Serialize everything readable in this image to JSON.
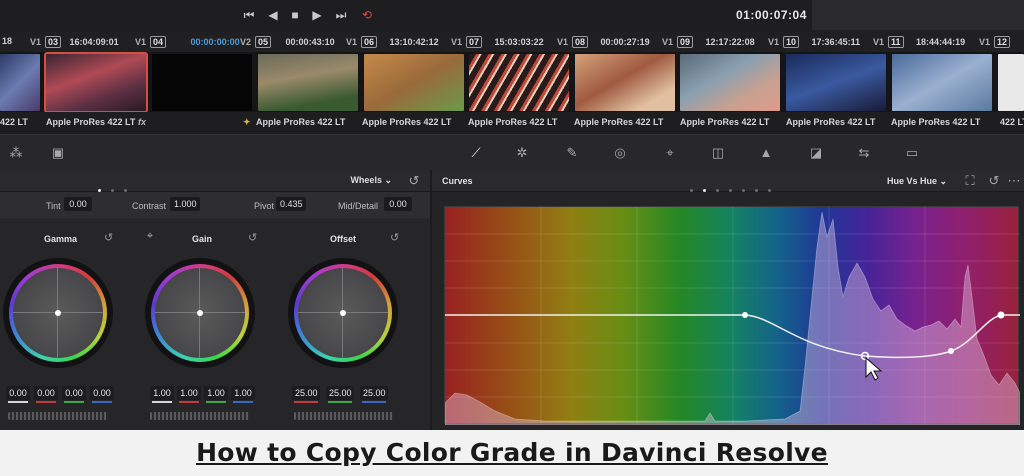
{
  "transport": {
    "timecode": "01:00:07:04",
    "buttons": [
      "skip-back-icon",
      "play-reverse-icon",
      "stop-icon",
      "play-icon",
      "skip-forward-icon",
      "loop-icon"
    ]
  },
  "timeline": {
    "clips": [
      {
        "num": "",
        "timecode": "",
        "track": "",
        "name": "422 LT"
      },
      {
        "num": "03",
        "timecode": "16:04:09:01",
        "track": "V1",
        "name": "Apple ProRes 422 LT",
        "fx": "fx"
      },
      {
        "num": "04",
        "timecode": "00:00:00:00",
        "track": "V1",
        "name": ""
      },
      {
        "num": "05",
        "timecode": "00:00:43:10",
        "track": "V2",
        "name": "Apple ProRes 422 LT"
      },
      {
        "num": "06",
        "timecode": "13:10:42:12",
        "track": "V1",
        "name": "Apple ProRes 422 LT"
      },
      {
        "num": "07",
        "timecode": "15:03:03:22",
        "track": "V1",
        "name": "Apple ProRes 422 LT"
      },
      {
        "num": "08",
        "timecode": "00:00:27:19",
        "track": "V1",
        "name": "Apple ProRes 422 LT"
      },
      {
        "num": "09",
        "timecode": "12:17:22:08",
        "track": "V1",
        "name": "Apple ProRes 422 LT"
      },
      {
        "num": "10",
        "timecode": "17:36:45:11",
        "track": "V1",
        "name": "Apple ProRes 422 LT"
      },
      {
        "num": "11",
        "timecode": "18:44:44:19",
        "track": "V1",
        "name": "Apple ProRes 422 LT"
      },
      {
        "num": "12",
        "timecode": "",
        "track": "V1",
        "name": "422 LT"
      }
    ],
    "first_tc": "18"
  },
  "wheels_panel": {
    "mode": "Wheels",
    "params": {
      "tint_label": "Tint",
      "tint": "0.00",
      "contrast_label": "Contrast",
      "contrast": "1.000",
      "pivot_label": "Pivot",
      "pivot": "0.435",
      "middetail_label": "Mid/Detail",
      "middetail": "0.00"
    },
    "wheels": [
      {
        "label": "Gamma",
        "values": [
          "0.00",
          "0.00",
          "0.00",
          "0.00"
        ]
      },
      {
        "label": "Gain",
        "values": [
          "1.00",
          "1.00",
          "1.00",
          "1.00"
        ]
      },
      {
        "label": "Offset",
        "values": [
          "25.00",
          "25.00",
          "25.00"
        ]
      }
    ]
  },
  "curves_panel": {
    "title": "Curves",
    "mode": "Hue Vs Hue"
  },
  "caption": "How to Copy Color Grade in Davinci Resolve",
  "colors": {
    "selected_clip": "#d2503f",
    "timecode_blue": "#4a9bd9"
  }
}
